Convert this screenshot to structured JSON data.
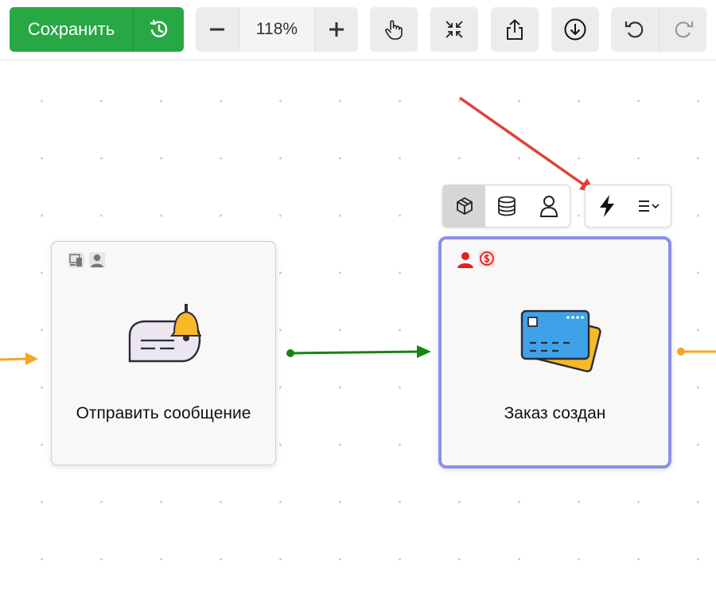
{
  "toolbar": {
    "save_label": "Сохранить",
    "zoom_value": "118%",
    "history_icon": "history-icon",
    "zoom_out_icon": "minus-icon",
    "zoom_in_icon": "plus-icon",
    "pan_icon": "hand-pointer-icon",
    "fit_icon": "collapse-arrows-icon",
    "share_icon": "upload-icon",
    "download_icon": "download-circle-icon",
    "undo_icon": "undo-icon",
    "redo_icon": "redo-icon"
  },
  "nodes": [
    {
      "label": "Отправить сообщение",
      "icon": "message-bell-icon",
      "badges": [
        "devices-icon",
        "user-icon"
      ]
    },
    {
      "label": "Заказ создан",
      "icon": "credit-cards-icon",
      "badges": [
        "user-icon",
        "dollar-circle-icon"
      ],
      "selected": true
    }
  ],
  "node_popover": {
    "tabs": [
      "box-icon",
      "database-icon",
      "person-icon"
    ],
    "actions": [
      "lightning-icon",
      "menu-dropdown-icon"
    ]
  },
  "colors": {
    "save_green": "#28a745",
    "selected_border": "#8e8ee8",
    "connector_green": "#148514",
    "connector_orange": "#f5a623",
    "annotation_red": "#e0413a",
    "badge_red": "#e02020"
  }
}
